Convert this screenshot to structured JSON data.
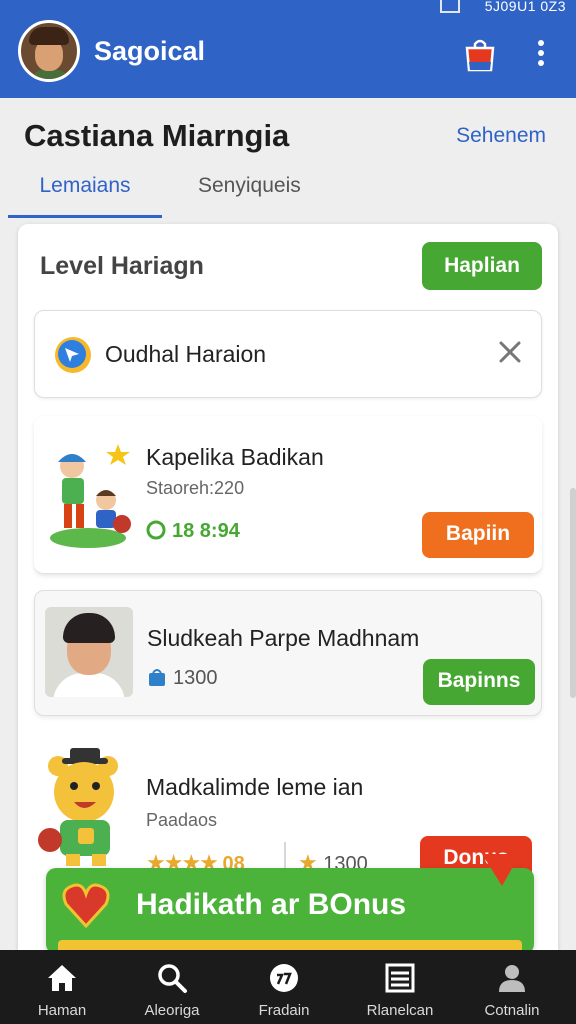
{
  "status_bar": {
    "right_text": "5J09U1 0Z3"
  },
  "app_bar": {
    "title": "Sagoical",
    "accent_color": "#2f63c6",
    "icons": [
      "avatar",
      "shopping-bag-icon",
      "more-vertical-icon"
    ]
  },
  "header": {
    "title": "Castiana Miarngia",
    "link": "Sehenem",
    "tabs": [
      {
        "label": "Lemaians",
        "active": true
      },
      {
        "label": "Senyiqueis",
        "active": false
      }
    ]
  },
  "card": {
    "title": "Level Hariagn",
    "action_label": "Haplian",
    "search_item": {
      "label": "Oudhal Haraion"
    },
    "items": [
      {
        "title": "Kapelika Badikan",
        "subtitle": "Staoreh:220",
        "meta": "18 8:94",
        "meta_color": "#46a832",
        "button": "Bapiin",
        "button_color": "#f06f1e"
      },
      {
        "title": "Sludkeah Parpe Madhnam",
        "meta": "1300",
        "button": "Bapinns",
        "button_color": "#46a832"
      },
      {
        "title": "Madkalimde leme ian",
        "subtitle": "Paadaos",
        "rating_text": "08",
        "rating": 4,
        "points": "1300",
        "button": "Donus",
        "button_color": "#e5391f"
      }
    ],
    "banner": {
      "text": "Hadikath ar BOnus",
      "color": "#4bb33a"
    }
  },
  "bottom_nav": [
    {
      "label": "Haman",
      "icon": "home-icon"
    },
    {
      "label": "Aleoriga",
      "icon": "search-icon"
    },
    {
      "label": "Fradain",
      "icon": "ball-icon"
    },
    {
      "label": "Rlanelcan",
      "icon": "list-icon"
    },
    {
      "label": "Cotnalin",
      "icon": "profile-icon"
    }
  ]
}
